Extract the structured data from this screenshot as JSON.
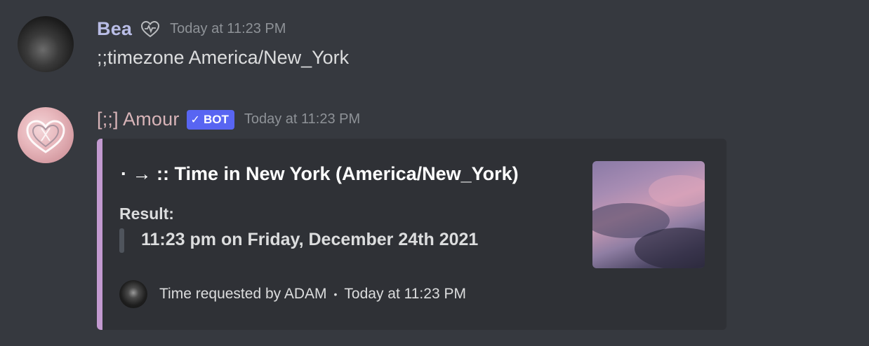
{
  "messages": [
    {
      "author": "Bea",
      "timestamp": "Today at 11:23 PM",
      "badge_icon": "heart-outline-icon",
      "content": ";;timezone America/New_York"
    },
    {
      "author": "[;;] Amour",
      "bot_badge": "BOT",
      "timestamp": "Today at 11:23 PM",
      "embed": {
        "accent_color": "#c39ad0",
        "title": "· → :: Time in New York (America/New_York)",
        "field_name": "Result:",
        "field_value": "11:23 pm on Friday, December 24th 2021",
        "footer_text": "Time requested by ADAM",
        "footer_separator": "•",
        "footer_timestamp": "Today at 11:23 PM"
      }
    }
  ],
  "colors": {
    "background": "#36393f",
    "embed_background": "#2f3136",
    "bot_badge": "#5865f2",
    "bea_name": "#b9bde6",
    "amour_name": "#d8b4b8"
  }
}
